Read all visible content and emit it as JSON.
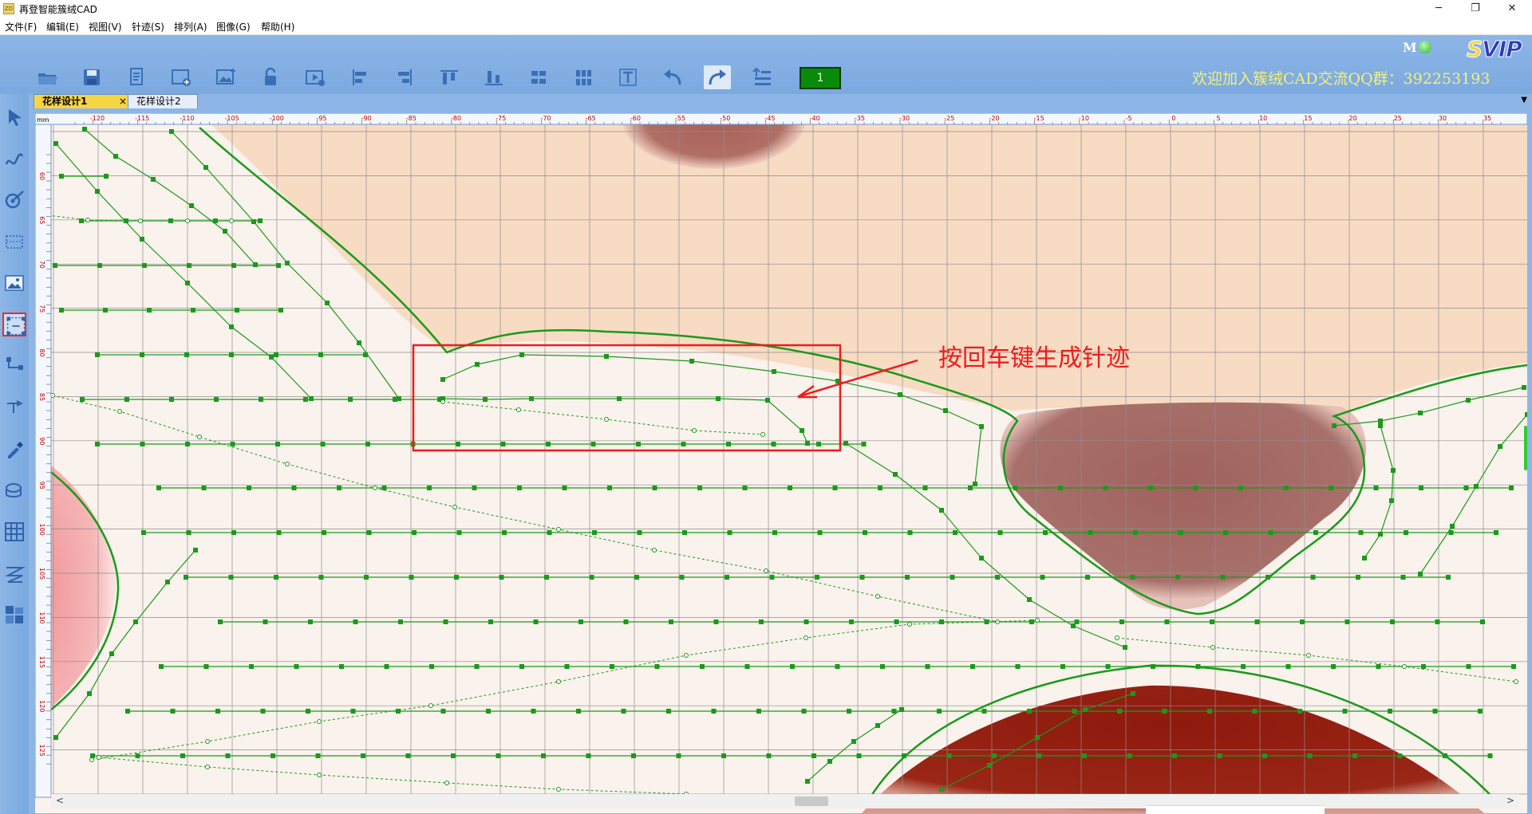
{
  "window": {
    "title": "再登智能簇绒CAD",
    "app_icon_text": "ZD",
    "minimize_glyph": "─",
    "maximize_glyph": "❐",
    "close_glyph": "✕"
  },
  "menu": [
    {
      "label": "文件(F)"
    },
    {
      "label": "编辑(E)"
    },
    {
      "label": "视图(V)"
    },
    {
      "label": "针迹(S)"
    },
    {
      "label": "排列(A)"
    },
    {
      "label": "图像(G)"
    },
    {
      "label": "帮助(H)"
    }
  ],
  "toolbar": {
    "tools": [
      {
        "icon": "open-folder-icon"
      },
      {
        "icon": "save-icon"
      },
      {
        "icon": "document-list-icon"
      },
      {
        "icon": "new-window-icon"
      },
      {
        "icon": "add-image-icon"
      },
      {
        "icon": "unlock-icon"
      },
      {
        "icon": "video-play-icon"
      },
      {
        "icon": "align-left-icon"
      },
      {
        "icon": "align-right-icon"
      },
      {
        "icon": "align-top-icon"
      },
      {
        "icon": "align-bottom-icon"
      },
      {
        "icon": "distribute-horizontal-icon"
      },
      {
        "icon": "distribute-vertical-icon"
      },
      {
        "icon": "text-tool-icon"
      },
      {
        "icon": "undo-icon"
      },
      {
        "icon": "redo-icon"
      },
      {
        "icon": "list-order-icon"
      }
    ],
    "layer_value": "1",
    "m_label": "M",
    "status_color": "#2ebc2e",
    "svip_text": "SVIP",
    "welcome_text": "欢迎加入簇绒CAD交流QQ群：392253193"
  },
  "left_tools": [
    {
      "icon": "pointer-arrow-icon"
    },
    {
      "icon": "curve-draw-icon"
    },
    {
      "icon": "edit-node-icon"
    },
    {
      "icon": "select-rect-icon"
    },
    {
      "icon": "image-icon"
    },
    {
      "icon": "generate-stitch-icon"
    },
    {
      "icon": "connect-path-icon"
    },
    {
      "icon": "start-point-icon"
    },
    {
      "icon": "eyedropper-icon"
    },
    {
      "icon": "fill-bucket-icon"
    },
    {
      "icon": "grid-icon"
    },
    {
      "icon": "hatch-fill-icon"
    },
    {
      "icon": "layer-blocks-icon"
    }
  ],
  "tabs": [
    {
      "label": "花样设计1",
      "close": "×"
    },
    {
      "label": "花样设计2"
    }
  ],
  "tab_menu_glyph": "▼",
  "ruler": {
    "unit": "mm",
    "x_labels": [
      "-120",
      "-115",
      "-110",
      "-105",
      "-100",
      "-95",
      "-90",
      "-85",
      "-80",
      "-75",
      "-70",
      "-65",
      "-60",
      "-55",
      "-50",
      "-45",
      "-40",
      "-35",
      "-30",
      "-25",
      "-20",
      "-15",
      "-10",
      "-5",
      "0",
      "5",
      "10",
      "15",
      "20",
      "25",
      "30",
      "35"
    ],
    "y_labels": [
      "60",
      "65",
      "70",
      "75",
      "80",
      "85",
      "90",
      "95",
      "100",
      "105",
      "110",
      "115",
      "120",
      "125"
    ]
  },
  "colors": {
    "stitch": "#1a9a1a",
    "annotation": "#ee1c1c",
    "skin": "#f8dcc4",
    "dark_red": "#8b1a12",
    "mauve": "#a86a6a"
  },
  "callout_text": "按回车键生成针迹",
  "scrollbar": {
    "left_glyph": "<",
    "right_glyph": ">"
  }
}
